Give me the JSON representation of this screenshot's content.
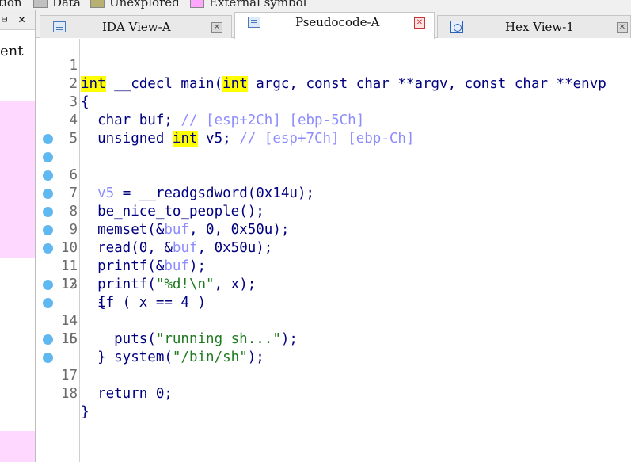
{
  "legend": {
    "items": [
      {
        "label": "tion",
        "color": null
      },
      {
        "label": "Data",
        "color": "#c0c0c0"
      },
      {
        "label": "Unexplored",
        "color": "#b8b070"
      },
      {
        "label": "External symbol",
        "color": "#ffa6ff"
      }
    ]
  },
  "left_panel": {
    "pin_icon": "pin-icon",
    "close_icon": "close-icon",
    "close_glyph": "✕",
    "text": "ent",
    "highlight_color": "#ffd8ff"
  },
  "tabs": [
    {
      "label": "IDA View-A",
      "icon": "ida-view-icon",
      "active": false,
      "close_glyph": "✕"
    },
    {
      "label": "Pseudocode-A",
      "icon": "pseudocode-icon",
      "active": true,
      "close_glyph": "✕"
    },
    {
      "label": "Hex View-1",
      "icon": "hex-view-icon",
      "active": false,
      "close_glyph": "✕"
    }
  ],
  "code": {
    "breakpoint_color": "#5fb8ef",
    "lines": [
      {
        "num": "1",
        "dot": false
      },
      {
        "num": "2",
        "dot": false
      },
      {
        "num": "3",
        "dot": false
      },
      {
        "num": "4",
        "dot": false
      },
      {
        "num": "5",
        "dot": false
      },
      {
        "num": "6",
        "dot": true
      },
      {
        "num": "7",
        "dot": true
      },
      {
        "num": "8",
        "dot": true
      },
      {
        "num": "9",
        "dot": true
      },
      {
        "num": "10",
        "dot": true
      },
      {
        "num": "11",
        "dot": true
      },
      {
        "num": "12",
        "dot": true
      },
      {
        "num": "13",
        "dot": false
      },
      {
        "num": "14",
        "dot": true
      },
      {
        "num": "15",
        "dot": true
      },
      {
        "num": "16",
        "dot": false
      },
      {
        "num": "17",
        "dot": true
      },
      {
        "num": "18",
        "dot": true
      }
    ],
    "tokens": {
      "l1": [
        "int",
        " __cdecl main(",
        "int",
        " argc, const char **argv, const char **envp"
      ],
      "l2": [
        "{"
      ],
      "l3": [
        "  char buf; ",
        "// [esp+2Ch] [ebp-5Ch]"
      ],
      "l4": [
        "  unsigned ",
        "int",
        " v5; ",
        "// [esp+7Ch] [ebp-Ch]"
      ],
      "l5": [
        ""
      ],
      "l6": [
        "  ",
        "v5",
        " = __readgsdword(0x14u);"
      ],
      "l7": [
        "  be_nice_to_people();"
      ],
      "l8": [
        "  memset(&",
        "buf",
        ", 0, 0x50u);"
      ],
      "l9": [
        "  read(0, &",
        "buf",
        ", 0x50u);"
      ],
      "l10": [
        "  printf(&",
        "buf",
        ");"
      ],
      "l11": [
        "  printf(",
        "\"%d!\\n\"",
        ", x);"
      ],
      "l12": [
        "  if ( x == 4 )"
      ],
      "l13": [
        "  {"
      ],
      "l14": [
        "    puts(",
        "\"running sh...\"",
        ");"
      ],
      "l15": [
        "    system(",
        "\"/bin/sh\"",
        ");"
      ],
      "l16": [
        "  }"
      ],
      "l17": [
        "  return 0;"
      ],
      "l18": [
        "}"
      ]
    }
  }
}
